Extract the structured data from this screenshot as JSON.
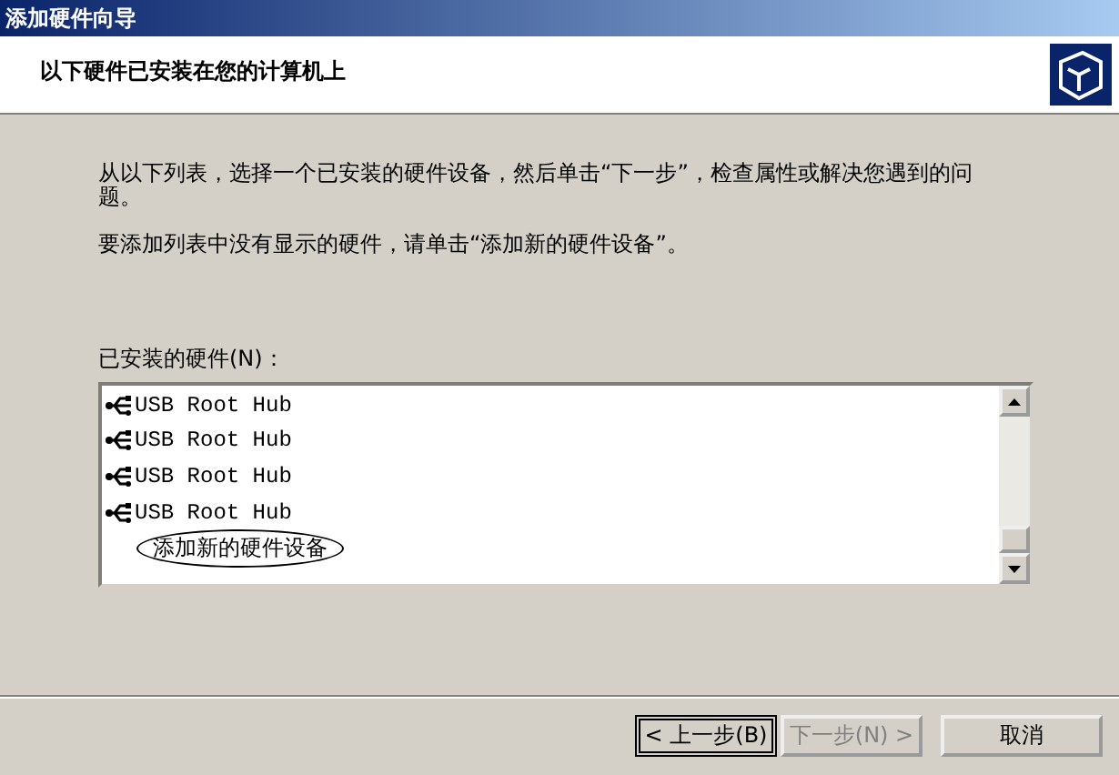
{
  "window": {
    "title": "添加硬件向导"
  },
  "header": {
    "title": "以下硬件已安装在您的计算机上"
  },
  "intro": "从以下列表，选择一个已安装的硬件设备，然后单击“下一步”，检查属性或解决您遇到的问题。",
  "hint": "要添加列表中没有显示的硬件，请单击“添加新的硬件设备”。",
  "list": {
    "label": "已安装的硬件(N)：",
    "items": [
      {
        "kind": "device",
        "label": "USB Root Hub",
        "circled": false
      },
      {
        "kind": "device",
        "label": "USB Root Hub",
        "circled": false
      },
      {
        "kind": "device",
        "label": "USB Root Hub",
        "circled": false
      },
      {
        "kind": "device",
        "label": "USB Root Hub",
        "circled": false
      },
      {
        "kind": "add",
        "label": "添加新的硬件设备",
        "circled": true
      }
    ]
  },
  "buttons": [
    {
      "label": "< 上一步(B)",
      "disabled": false,
      "default": true
    },
    {
      "label": "下一步(N) >",
      "disabled": true,
      "default": false
    },
    {
      "label": "取消",
      "disabled": false,
      "default": false
    }
  ]
}
